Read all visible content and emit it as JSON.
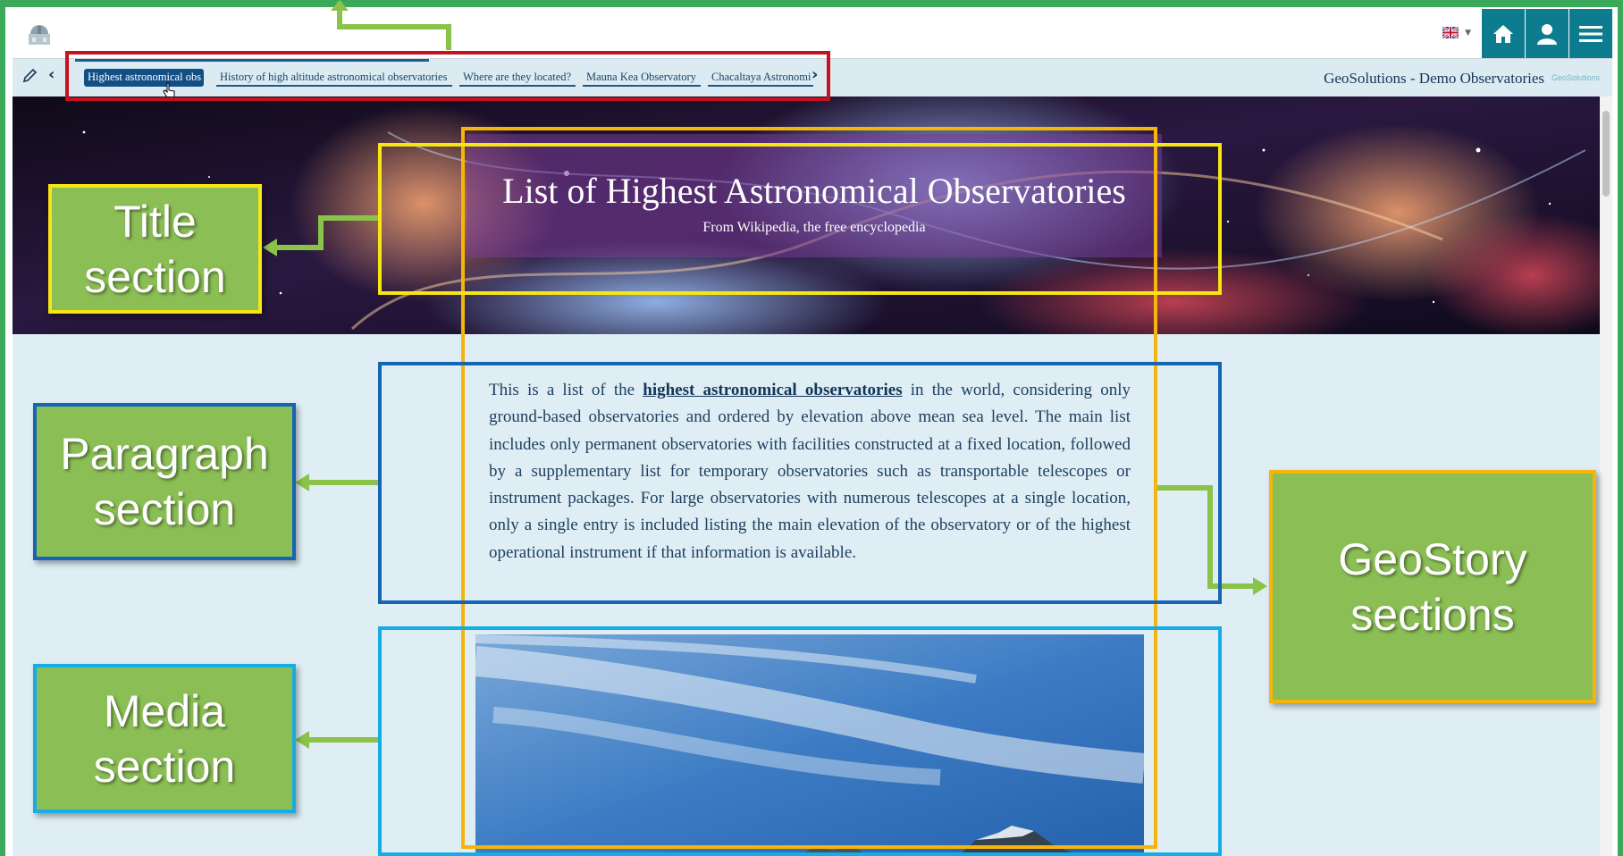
{
  "header": {
    "logo_icon": "observatory-logo-icon",
    "language_flag_icon": "uk-flag-icon",
    "buttons": [
      {
        "name": "home-button",
        "icon": "home-icon"
      },
      {
        "name": "user-button",
        "icon": "user-icon"
      },
      {
        "name": "menu-button",
        "icon": "hamburger-menu-icon"
      }
    ],
    "accent_color": "#0e7c8f"
  },
  "navbar": {
    "tabs": [
      {
        "label": "Highest astronomical obs",
        "active": true
      },
      {
        "label": "History of high altitude astronomical observatories",
        "active": false
      },
      {
        "label": "Where are they located?",
        "active": false
      },
      {
        "label": "Mauna Kea Observatory",
        "active": false
      },
      {
        "label": "Chacaltaya Astronomi",
        "active": false
      }
    ],
    "site_title": "GeoSolutions - Demo Observatories",
    "site_logo": "GeoSolutions"
  },
  "story": {
    "title": "List of Highest Astronomical Observatories",
    "subtitle": "From Wikipedia, the free encyclopedia",
    "paragraph": {
      "before": "This is a list of the ",
      "link": "highest astronomical observatories",
      "after": " in the world, considering only ground-based observatories and ordered by elevation above mean sea level. The main list includes only permanent observatories with facilities constructed at a fixed location, followed by a supplementary list for temporary observatories such as transportable telescopes or instrument packages. For large observatories with numerous telescopes at a single location, only a single entry is included listing the main elevation of the observatory or of the highest operational instrument if that information is available."
    }
  },
  "annotations": {
    "title_section": "Title section",
    "paragraph_section": "Paragraph section",
    "media_section": "Media section",
    "geostory_sections": "GeoStory sections",
    "colors": {
      "nav_box": "#c8101e",
      "title_box": "#f5e614",
      "paragraph_box": "#1565b5",
      "media_box": "#16ace6",
      "geostory_box": "#f5b50a",
      "label_fill": "#8bbf55",
      "connector": "#8bc34a"
    }
  }
}
